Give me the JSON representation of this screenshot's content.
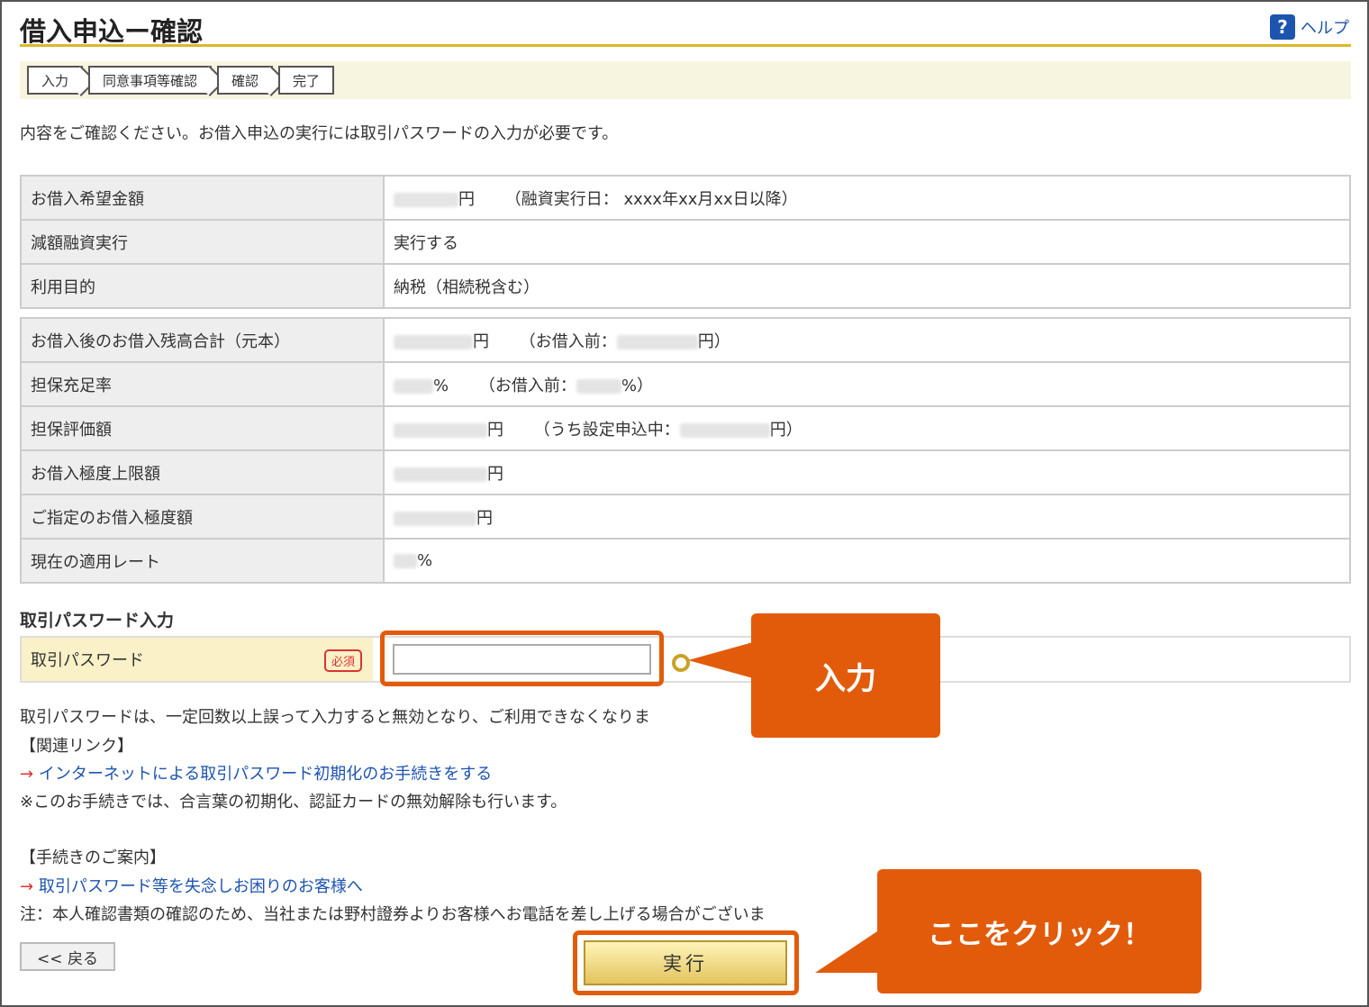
{
  "header": {
    "title": "借入申込ー確認",
    "help_label": "ヘルプ",
    "help_icon": "?"
  },
  "steps": [
    {
      "label": "入力"
    },
    {
      "label": "同意事項等確認"
    },
    {
      "label": "確認"
    },
    {
      "label": "完了"
    }
  ],
  "intro": "内容をご確認ください。お借入申込の実行には取引パスワードの入力が必要です。",
  "table1": [
    {
      "label": "お借入希望金額",
      "value_suffix": "円",
      "note": "（融資実行日： xxxx年xx月xx日以降）"
    },
    {
      "label": "減額融資実行",
      "value": "実行する"
    },
    {
      "label": "利用目的",
      "value": "納税（相続税含む）"
    }
  ],
  "table2": [
    {
      "label": "お借入後のお借入残高合計（元本）",
      "value_suffix": "円",
      "note_prefix": "（お借入前：",
      "note_suffix": "円）"
    },
    {
      "label": "担保充足率",
      "value_suffix": "%",
      "note_prefix": "（お借入前：",
      "note_suffix": "%）"
    },
    {
      "label": "担保評価額",
      "value_suffix": "円",
      "note_prefix": "（うち設定申込中：",
      "note_suffix": "円）"
    },
    {
      "label": "お借入極度上限額",
      "value_suffix": "円"
    },
    {
      "label": "ご指定のお借入極度額",
      "value_suffix": "円"
    },
    {
      "label": "現在の適用レート",
      "value_suffix": "%"
    }
  ],
  "password": {
    "heading": "取引パスワード入力",
    "label": "取引パスワード",
    "required": "必須"
  },
  "notes": {
    "warning": "取引パスワードは、一定回数以上誤って入力すると無効となり、ご利用できなくなりま",
    "related_heading": "【関連リンク】",
    "arrow": "→",
    "link1": "インターネットによる取引パスワード初期化のお手続きをする",
    "note1": "※このお手続きでは、合言葉の初期化、認証カードの無効解除も行います。",
    "guide_heading": "【手続きのご案内】",
    "link2": "取引パスワード等を失念しお困りのお客様へ",
    "note2": "注：本人確認書類の確認のため、当社または野村證券よりお客様へお電話を差し上げる場合がございま"
  },
  "buttons": {
    "back": "<< 戻る",
    "execute": "実行"
  },
  "callouts": {
    "input": "入力",
    "click": "ここをクリック！"
  },
  "colors": {
    "accent": "#e25b0a",
    "link": "#1d54b0",
    "gold": "#d9b928"
  }
}
